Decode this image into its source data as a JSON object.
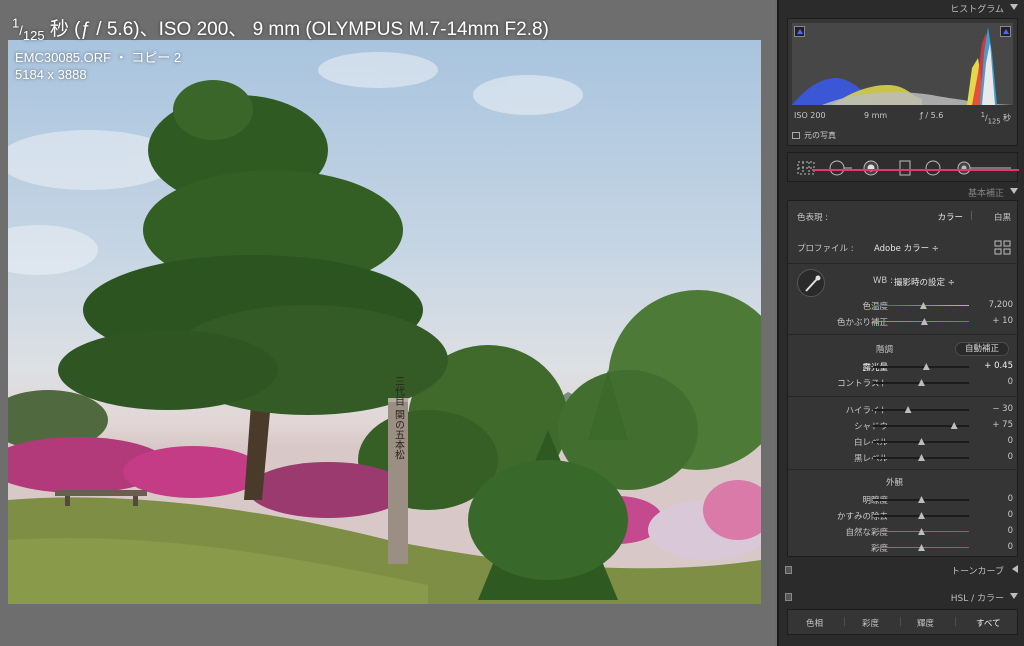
{
  "photo_overlay": {
    "exif_whole": "1",
    "exif_frac_den": "125",
    "exif_rest": " 秒 (ƒ / 5.6)、ISO 200、 9 mm (OLYMPUS M.7-14mm F2.8)",
    "filename": "EMC30085.ORF ・ コピー 2",
    "dimensions": "5184 x 3888",
    "post_text": "三代目 関の五本松"
  },
  "histogram": {
    "header": "ヒストグラム",
    "iso": "ISO 200",
    "focal": "9 mm",
    "aperture": "ƒ / 5.6",
    "shutter_whole": "1",
    "shutter_den": "125",
    "shutter_unit": "秒",
    "original_photo": "元の写真"
  },
  "basic": {
    "header": "基本補正",
    "treatment_label": "色表現 :",
    "treatment_color": "カラー",
    "treatment_sep": "|",
    "treatment_bw": "白黒",
    "profile_label": "プロファイル :",
    "profile_value": "Adobe カラー ÷",
    "wb_label": "WB :",
    "wb_value": "撮影時の設定 ÷",
    "tone_title": "階調",
    "auto_button": "自動補正",
    "presence_title": "外観",
    "sliders": [
      {
        "id": "temp",
        "label": "色温度",
        "value": "7,200",
        "pos": 0.52
      },
      {
        "id": "tint",
        "label": "色かぶり補正",
        "value": "+ 10",
        "pos": 0.53
      },
      {
        "id": "exposure",
        "label": "露光量",
        "value": "+ 0.45",
        "pos": 0.55
      },
      {
        "id": "contrast",
        "label": "コントラスト",
        "value": "0",
        "pos": 0.5
      },
      {
        "id": "highlights",
        "label": "ハイライト",
        "value": "− 30",
        "pos": 0.36
      },
      {
        "id": "shadows",
        "label": "シャドウ",
        "value": "+ 75",
        "pos": 0.84
      },
      {
        "id": "whites",
        "label": "白レベル",
        "value": "0",
        "pos": 0.5
      },
      {
        "id": "blacks",
        "label": "黒レベル",
        "value": "0",
        "pos": 0.5
      },
      {
        "id": "clarity",
        "label": "明瞭度",
        "value": "0",
        "pos": 0.5
      },
      {
        "id": "dehaze",
        "label": "かすみの除去",
        "value": "0",
        "pos": 0.5
      },
      {
        "id": "vibrance",
        "label": "自然な彩度",
        "value": "0",
        "pos": 0.5
      },
      {
        "id": "saturation",
        "label": "彩度",
        "value": "0",
        "pos": 0.5
      }
    ]
  },
  "tone_curve": {
    "header": "トーンカーブ"
  },
  "hsl": {
    "header": "HSL / カラー",
    "tabs": [
      "色相",
      "彩度",
      "輝度",
      "すべて"
    ],
    "sep": "|"
  },
  "colors": {
    "accent_line": "#e13870",
    "panel_bg": "#353535"
  }
}
